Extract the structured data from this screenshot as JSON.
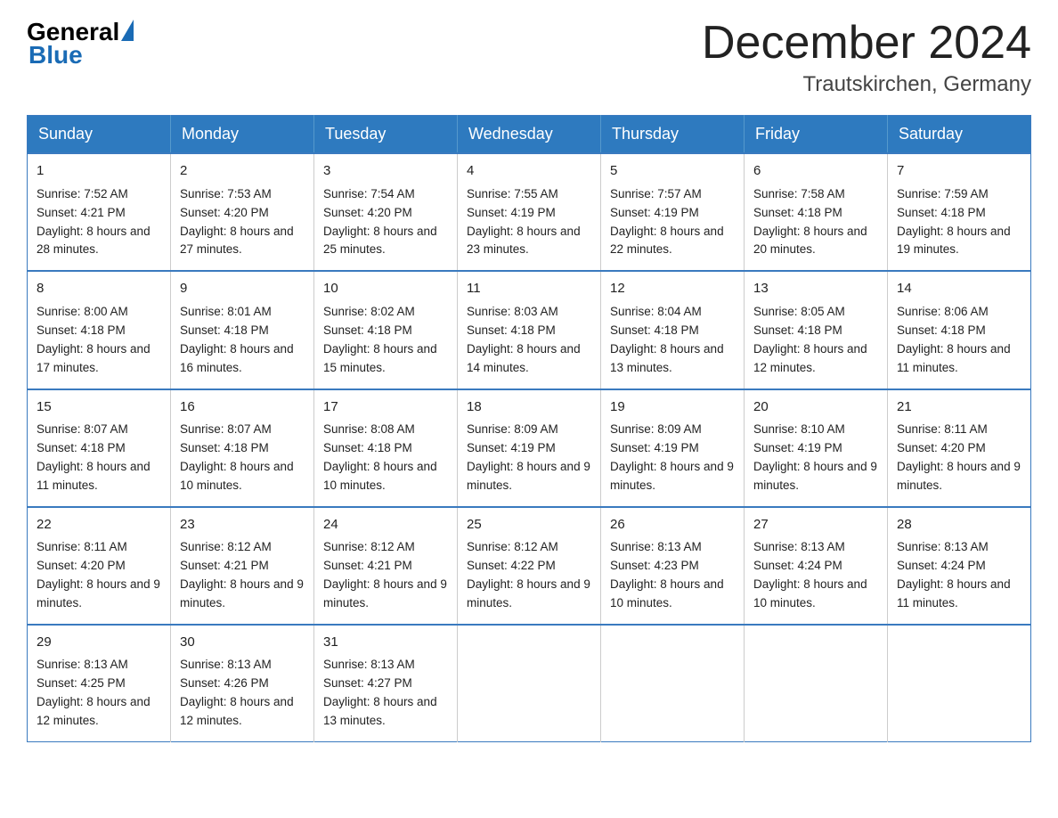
{
  "logo": {
    "general": "General",
    "blue": "Blue"
  },
  "header": {
    "month_title": "December 2024",
    "location": "Trautskirchen, Germany"
  },
  "weekdays": [
    "Sunday",
    "Monday",
    "Tuesday",
    "Wednesday",
    "Thursday",
    "Friday",
    "Saturday"
  ],
  "weeks": [
    [
      {
        "day": "1",
        "sunrise": "7:52 AM",
        "sunset": "4:21 PM",
        "daylight": "8 hours and 28 minutes."
      },
      {
        "day": "2",
        "sunrise": "7:53 AM",
        "sunset": "4:20 PM",
        "daylight": "8 hours and 27 minutes."
      },
      {
        "day": "3",
        "sunrise": "7:54 AM",
        "sunset": "4:20 PM",
        "daylight": "8 hours and 25 minutes."
      },
      {
        "day": "4",
        "sunrise": "7:55 AM",
        "sunset": "4:19 PM",
        "daylight": "8 hours and 23 minutes."
      },
      {
        "day": "5",
        "sunrise": "7:57 AM",
        "sunset": "4:19 PM",
        "daylight": "8 hours and 22 minutes."
      },
      {
        "day": "6",
        "sunrise": "7:58 AM",
        "sunset": "4:18 PM",
        "daylight": "8 hours and 20 minutes."
      },
      {
        "day": "7",
        "sunrise": "7:59 AM",
        "sunset": "4:18 PM",
        "daylight": "8 hours and 19 minutes."
      }
    ],
    [
      {
        "day": "8",
        "sunrise": "8:00 AM",
        "sunset": "4:18 PM",
        "daylight": "8 hours and 17 minutes."
      },
      {
        "day": "9",
        "sunrise": "8:01 AM",
        "sunset": "4:18 PM",
        "daylight": "8 hours and 16 minutes."
      },
      {
        "day": "10",
        "sunrise": "8:02 AM",
        "sunset": "4:18 PM",
        "daylight": "8 hours and 15 minutes."
      },
      {
        "day": "11",
        "sunrise": "8:03 AM",
        "sunset": "4:18 PM",
        "daylight": "8 hours and 14 minutes."
      },
      {
        "day": "12",
        "sunrise": "8:04 AM",
        "sunset": "4:18 PM",
        "daylight": "8 hours and 13 minutes."
      },
      {
        "day": "13",
        "sunrise": "8:05 AM",
        "sunset": "4:18 PM",
        "daylight": "8 hours and 12 minutes."
      },
      {
        "day": "14",
        "sunrise": "8:06 AM",
        "sunset": "4:18 PM",
        "daylight": "8 hours and 11 minutes."
      }
    ],
    [
      {
        "day": "15",
        "sunrise": "8:07 AM",
        "sunset": "4:18 PM",
        "daylight": "8 hours and 11 minutes."
      },
      {
        "day": "16",
        "sunrise": "8:07 AM",
        "sunset": "4:18 PM",
        "daylight": "8 hours and 10 minutes."
      },
      {
        "day": "17",
        "sunrise": "8:08 AM",
        "sunset": "4:18 PM",
        "daylight": "8 hours and 10 minutes."
      },
      {
        "day": "18",
        "sunrise": "8:09 AM",
        "sunset": "4:19 PM",
        "daylight": "8 hours and 9 minutes."
      },
      {
        "day": "19",
        "sunrise": "8:09 AM",
        "sunset": "4:19 PM",
        "daylight": "8 hours and 9 minutes."
      },
      {
        "day": "20",
        "sunrise": "8:10 AM",
        "sunset": "4:19 PM",
        "daylight": "8 hours and 9 minutes."
      },
      {
        "day": "21",
        "sunrise": "8:11 AM",
        "sunset": "4:20 PM",
        "daylight": "8 hours and 9 minutes."
      }
    ],
    [
      {
        "day": "22",
        "sunrise": "8:11 AM",
        "sunset": "4:20 PM",
        "daylight": "8 hours and 9 minutes."
      },
      {
        "day": "23",
        "sunrise": "8:12 AM",
        "sunset": "4:21 PM",
        "daylight": "8 hours and 9 minutes."
      },
      {
        "day": "24",
        "sunrise": "8:12 AM",
        "sunset": "4:21 PM",
        "daylight": "8 hours and 9 minutes."
      },
      {
        "day": "25",
        "sunrise": "8:12 AM",
        "sunset": "4:22 PM",
        "daylight": "8 hours and 9 minutes."
      },
      {
        "day": "26",
        "sunrise": "8:13 AM",
        "sunset": "4:23 PM",
        "daylight": "8 hours and 10 minutes."
      },
      {
        "day": "27",
        "sunrise": "8:13 AM",
        "sunset": "4:24 PM",
        "daylight": "8 hours and 10 minutes."
      },
      {
        "day": "28",
        "sunrise": "8:13 AM",
        "sunset": "4:24 PM",
        "daylight": "8 hours and 11 minutes."
      }
    ],
    [
      {
        "day": "29",
        "sunrise": "8:13 AM",
        "sunset": "4:25 PM",
        "daylight": "8 hours and 12 minutes."
      },
      {
        "day": "30",
        "sunrise": "8:13 AM",
        "sunset": "4:26 PM",
        "daylight": "8 hours and 12 minutes."
      },
      {
        "day": "31",
        "sunrise": "8:13 AM",
        "sunset": "4:27 PM",
        "daylight": "8 hours and 13 minutes."
      },
      null,
      null,
      null,
      null
    ]
  ]
}
